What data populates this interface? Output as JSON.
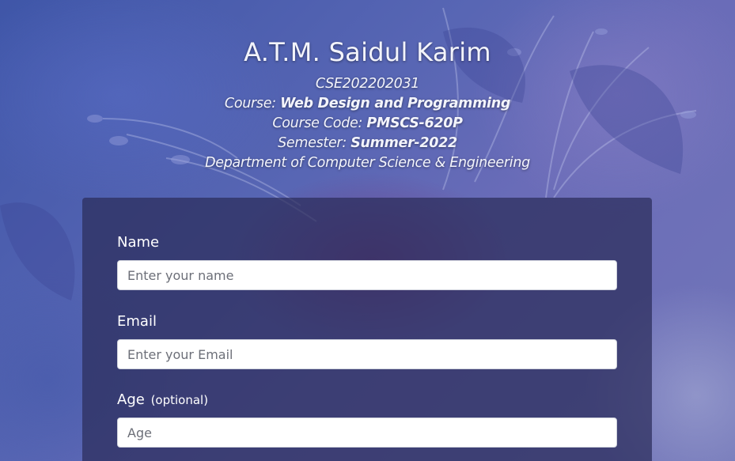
{
  "header": {
    "name": "A.T.M. Saidul Karim",
    "student_id": "CSE202202031",
    "course_label": "Course:",
    "course_value": "Web Design and Programming",
    "course_code_label": "Course Code:",
    "course_code_value": "PMSCS-620P",
    "semester_label": "Semester:",
    "semester_value": "Summer-2022",
    "department": "Department of Computer Science & Engineering"
  },
  "form": {
    "name": {
      "label": "Name",
      "placeholder": "Enter your name",
      "value": ""
    },
    "email": {
      "label": "Email",
      "placeholder": "Enter your Email",
      "value": ""
    },
    "age": {
      "label": "Age",
      "label_note": "(optional)",
      "placeholder": "Age",
      "value": ""
    }
  },
  "colors": {
    "background": "#5866b4",
    "card": "#2b2d5a",
    "text": "#ffffff"
  }
}
